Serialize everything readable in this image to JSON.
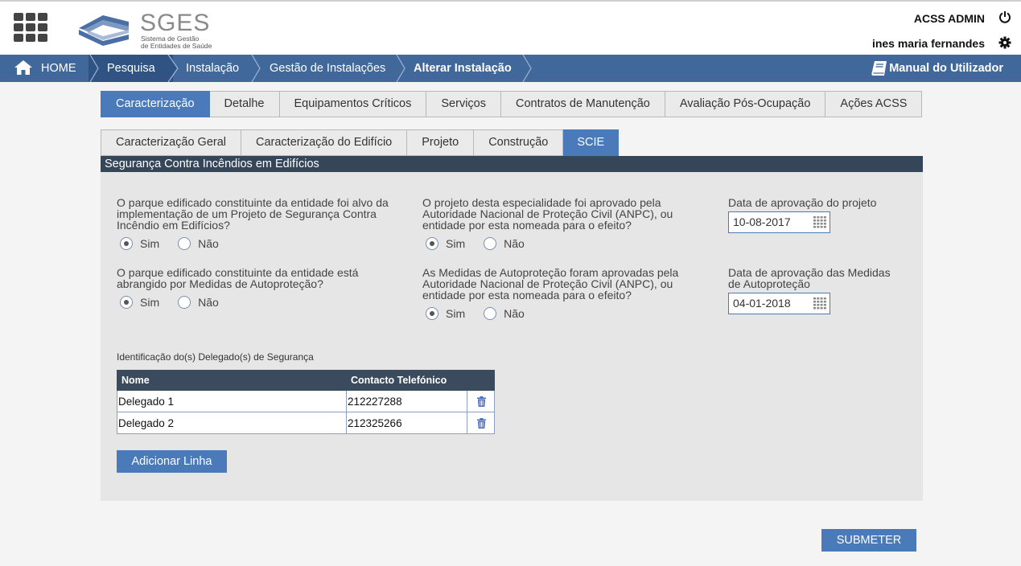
{
  "header": {
    "logo_title": "SGES",
    "logo_subtitle_line1": "Sistema de Gestão",
    "logo_subtitle_line2": "de Entidades de Saúde",
    "admin_label": "ACSS ADMIN",
    "user_label": "ines maria fernandes"
  },
  "breadcrumb": {
    "items": [
      {
        "label": "HOME"
      },
      {
        "label": "Pesquisa"
      },
      {
        "label": "Instalação"
      },
      {
        "label": "Gestão de Instalações"
      },
      {
        "label": "Alterar Instalação"
      }
    ],
    "manual_label": "Manual do Utilizador"
  },
  "tabs_main": [
    {
      "label": "Caracterização",
      "active": true
    },
    {
      "label": "Detalhe"
    },
    {
      "label": "Equipamentos Críticos"
    },
    {
      "label": "Serviços"
    },
    {
      "label": "Contratos de Manutenção"
    },
    {
      "label": "Avaliação Pós-Ocupação"
    },
    {
      "label": "Ações ACSS"
    }
  ],
  "tabs_sub": [
    {
      "label": "Caracterização Geral"
    },
    {
      "label": "Caracterização do Edifício"
    },
    {
      "label": "Projeto"
    },
    {
      "label": "Construção"
    },
    {
      "label": "SCIE",
      "active": true
    }
  ],
  "panel": {
    "title": "Segurança Contra Incêndios em Edifícios",
    "q1": "O parque edificado constituinte da entidade foi alvo da implementação de um Projeto de Segurança Contra Incêndio em Edifícios?",
    "q2": "O projeto desta especialidade foi aprovado pela Autoridade Nacional de Proteção Civil (ANPC), ou entidade por esta nomeada para o efeito?",
    "q3_label": "Data de aprovação do projeto",
    "q3_value": "10-08-2017",
    "q4": "O parque edificado constituinte da entidade está abrangido por Medidas de Autoproteção?",
    "q5": "As Medidas de Autoproteção foram aprovadas pela Autoridade Nacional de Proteção Civil (ANPC), ou entidade por esta nomeada para o efeito?",
    "q6_label": "Data de aprovação das Medidas de Autoproteção",
    "q6_value": "04-01-2018",
    "yes_label": "Sim",
    "no_label": "Não",
    "table_caption": "Identificação do(s) Delegado(s) de Segurança",
    "table_headers": [
      "Nome",
      "Contacto Telefónico"
    ],
    "table_rows": [
      {
        "nome": "Delegado 1",
        "contacto": "212227288"
      },
      {
        "nome": "Delegado 2",
        "contacto": "212325266"
      }
    ],
    "add_row_label": "Adicionar Linha"
  },
  "submit_label": "SUBMETER",
  "colors": {
    "accent": "#4a7ab9",
    "breadcrumb_bg": "#41689b",
    "panel_title_bg": "#364659"
  }
}
